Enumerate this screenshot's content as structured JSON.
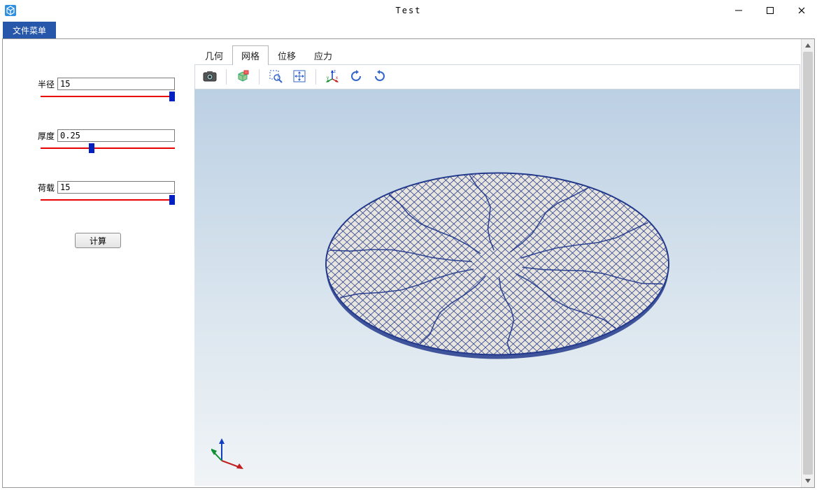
{
  "window": {
    "title": "Test",
    "min_tooltip": "Minimize",
    "max_tooltip": "Maximize",
    "close_tooltip": "Close"
  },
  "menubar": {
    "file_menu": "文件菜单"
  },
  "params": {
    "radius": {
      "label": "半径",
      "value": "15",
      "slider_pos": 0.98
    },
    "thickness": {
      "label": "厚度",
      "value": "0.25",
      "slider_pos": 0.38
    },
    "load": {
      "label": "荷载",
      "value": "15",
      "slider_pos": 0.98
    }
  },
  "calc_button": "计算",
  "tabs": [
    {
      "label": "几何",
      "active": false
    },
    {
      "label": "网格",
      "active": true
    },
    {
      "label": "位移",
      "active": false
    },
    {
      "label": "应力",
      "active": false
    }
  ],
  "toolbar": {
    "screenshot": "screenshot",
    "select": "select-mode",
    "zoom_box": "zoom-box",
    "pan": "pan",
    "axes": "toggle-axes",
    "rotate_ccw": "rotate-ccw",
    "rotate_cw": "rotate-cw"
  },
  "colors": {
    "menu_bg": "#2757aa",
    "slider_track": "#e60000",
    "slider_thumb": "#0020c0",
    "mesh_line": "#233a8c",
    "viewport_top": "#bcd0e4",
    "viewport_bottom": "#f0f4f7"
  }
}
